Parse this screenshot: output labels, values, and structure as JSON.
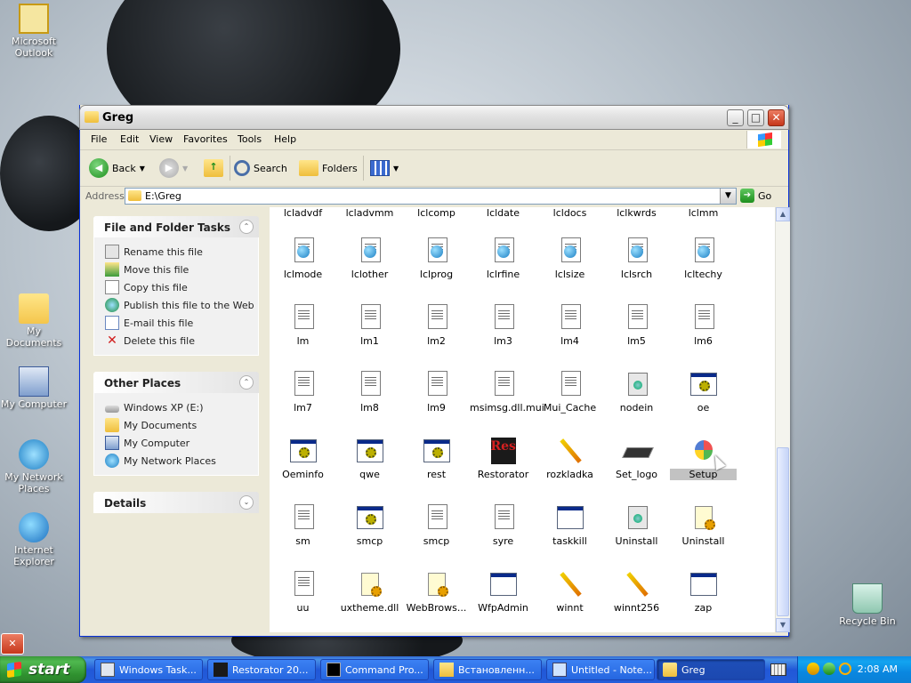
{
  "desktop": {
    "icons": [
      {
        "label": "Microsoft Outlook"
      },
      {
        "label": "My Documents"
      },
      {
        "label": "My Computer"
      },
      {
        "label": "My Network Places"
      },
      {
        "label": "Internet Explorer"
      },
      {
        "label": "Recycle Bin"
      }
    ]
  },
  "window": {
    "title": "Greg",
    "menu": [
      "File",
      "Edit",
      "View",
      "Favorites",
      "Tools",
      "Help"
    ],
    "toolbar": {
      "back": "Back",
      "search": "Search",
      "folders": "Folders"
    },
    "address": {
      "label": "Address",
      "value": "E:\\Greg",
      "go": "Go"
    }
  },
  "taskpane": {
    "file_tasks": {
      "title": "File and Folder Tasks",
      "items": [
        "Rename this file",
        "Move this file",
        "Copy this file",
        "Publish this file to the Web",
        "E-mail this file",
        "Delete this file"
      ]
    },
    "other_places": {
      "title": "Other Places",
      "items": [
        "Windows XP (E:)",
        "My Documents",
        "My Computer",
        "My Network Places"
      ]
    },
    "details": {
      "title": "Details"
    }
  },
  "files": {
    "top_row": [
      "lcladvdf",
      "lcladvmm",
      "lclcomp",
      "lcldate",
      "lcldocs",
      "lclkwrds",
      "lclmm"
    ],
    "rows": [
      [
        "lclmode",
        "lclother",
        "lclprog",
        "lclrfine",
        "lclsize",
        "lclsrch",
        "lcltechy"
      ],
      [
        "lm",
        "lm1",
        "lm2",
        "lm3",
        "lm4",
        "lm5",
        "lm6"
      ],
      [
        "lm7",
        "lm8",
        "lm9",
        "msimsg.dll.mui",
        "Mui_Cache",
        "nodein",
        "oe"
      ],
      [
        "Oeminfo",
        "qwe",
        "rest",
        "Restorator",
        "rozkladka",
        "Set_logo",
        "Setup"
      ],
      [
        "sm",
        "smcp",
        "smcp",
        "syre",
        "taskkill",
        "Uninstall",
        "Uninstall"
      ],
      [
        "uu",
        "uxtheme.dll",
        "WebBrows...",
        "WfpAdmin",
        "winnt",
        "winnt256",
        "zap"
      ]
    ],
    "selected": "Setup",
    "restorator_icon_text": "Res"
  },
  "taskbar": {
    "start": "start",
    "buttons": [
      "Windows Task...",
      "Restorator 20...",
      "Command Pro...",
      "Встановленн...",
      "Untitled - Note...",
      "Greg"
    ],
    "clock": "2:08 AM"
  }
}
